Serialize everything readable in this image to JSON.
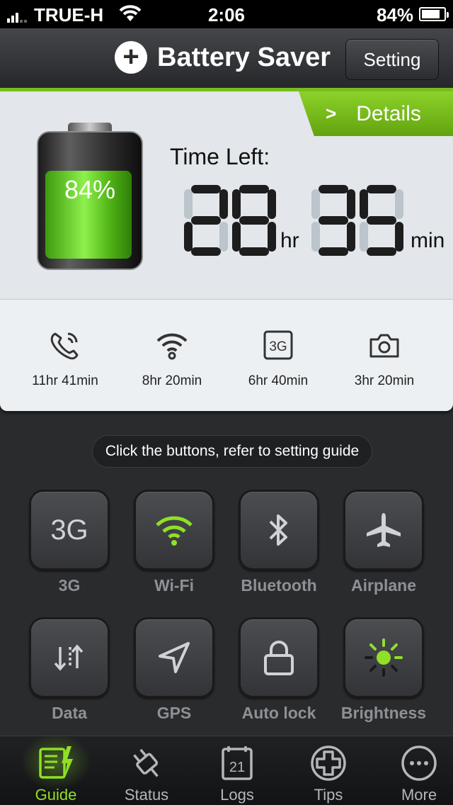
{
  "status_bar": {
    "carrier": "TRUE-H",
    "time": "2:06",
    "battery_percent": "84%",
    "battery_level": 0.84
  },
  "header": {
    "title": "Battery Saver",
    "setting_label": "Setting"
  },
  "panel": {
    "details_label": "Details",
    "battery_percent": "84%",
    "battery_level": 0.84,
    "time_left_label": "Time Left:",
    "hours": "28",
    "hours_unit": "hr",
    "minutes": "35",
    "minutes_unit": "min",
    "accent_color": "#79be1e"
  },
  "usage": [
    {
      "icon": "phone-call-icon",
      "value": "11hr 41min"
    },
    {
      "icon": "wifi-icon",
      "value": "8hr 20min"
    },
    {
      "icon": "3g-icon",
      "value": "6hr 40min",
      "icon_text": "3G"
    },
    {
      "icon": "camera-icon",
      "value": "3hr 20min"
    }
  ],
  "guide_hint": "Click the buttons, refer to setting guide",
  "toggles": [
    {
      "label": "3G",
      "icon": "3g-text-icon",
      "icon_text": "3G",
      "active": false
    },
    {
      "label": "Wi-Fi",
      "icon": "wifi-icon",
      "active": true
    },
    {
      "label": "Bluetooth",
      "icon": "bluetooth-icon",
      "active": false
    },
    {
      "label": "Airplane",
      "icon": "airplane-icon",
      "active": false
    },
    {
      "label": "Data",
      "icon": "data-transfer-icon",
      "active": false
    },
    {
      "label": "GPS",
      "icon": "location-arrow-icon",
      "active": false
    },
    {
      "label": "Auto lock",
      "icon": "lock-icon",
      "active": false
    },
    {
      "label": "Brightness",
      "icon": "sun-icon",
      "active": true
    }
  ],
  "tabs": [
    {
      "label": "Guide",
      "icon": "guide-icon",
      "active": true
    },
    {
      "label": "Status",
      "icon": "plug-icon",
      "active": false
    },
    {
      "label": "Logs",
      "icon": "calendar-icon",
      "icon_text": "21",
      "active": false
    },
    {
      "label": "Tips",
      "icon": "plus-circle-icon",
      "active": false
    },
    {
      "label": "More",
      "icon": "more-icon",
      "active": false
    }
  ],
  "colors": {
    "active_green": "#8fe026",
    "dark_bg": "#2a2b2d",
    "panel_bg": "#e3e6ea"
  }
}
